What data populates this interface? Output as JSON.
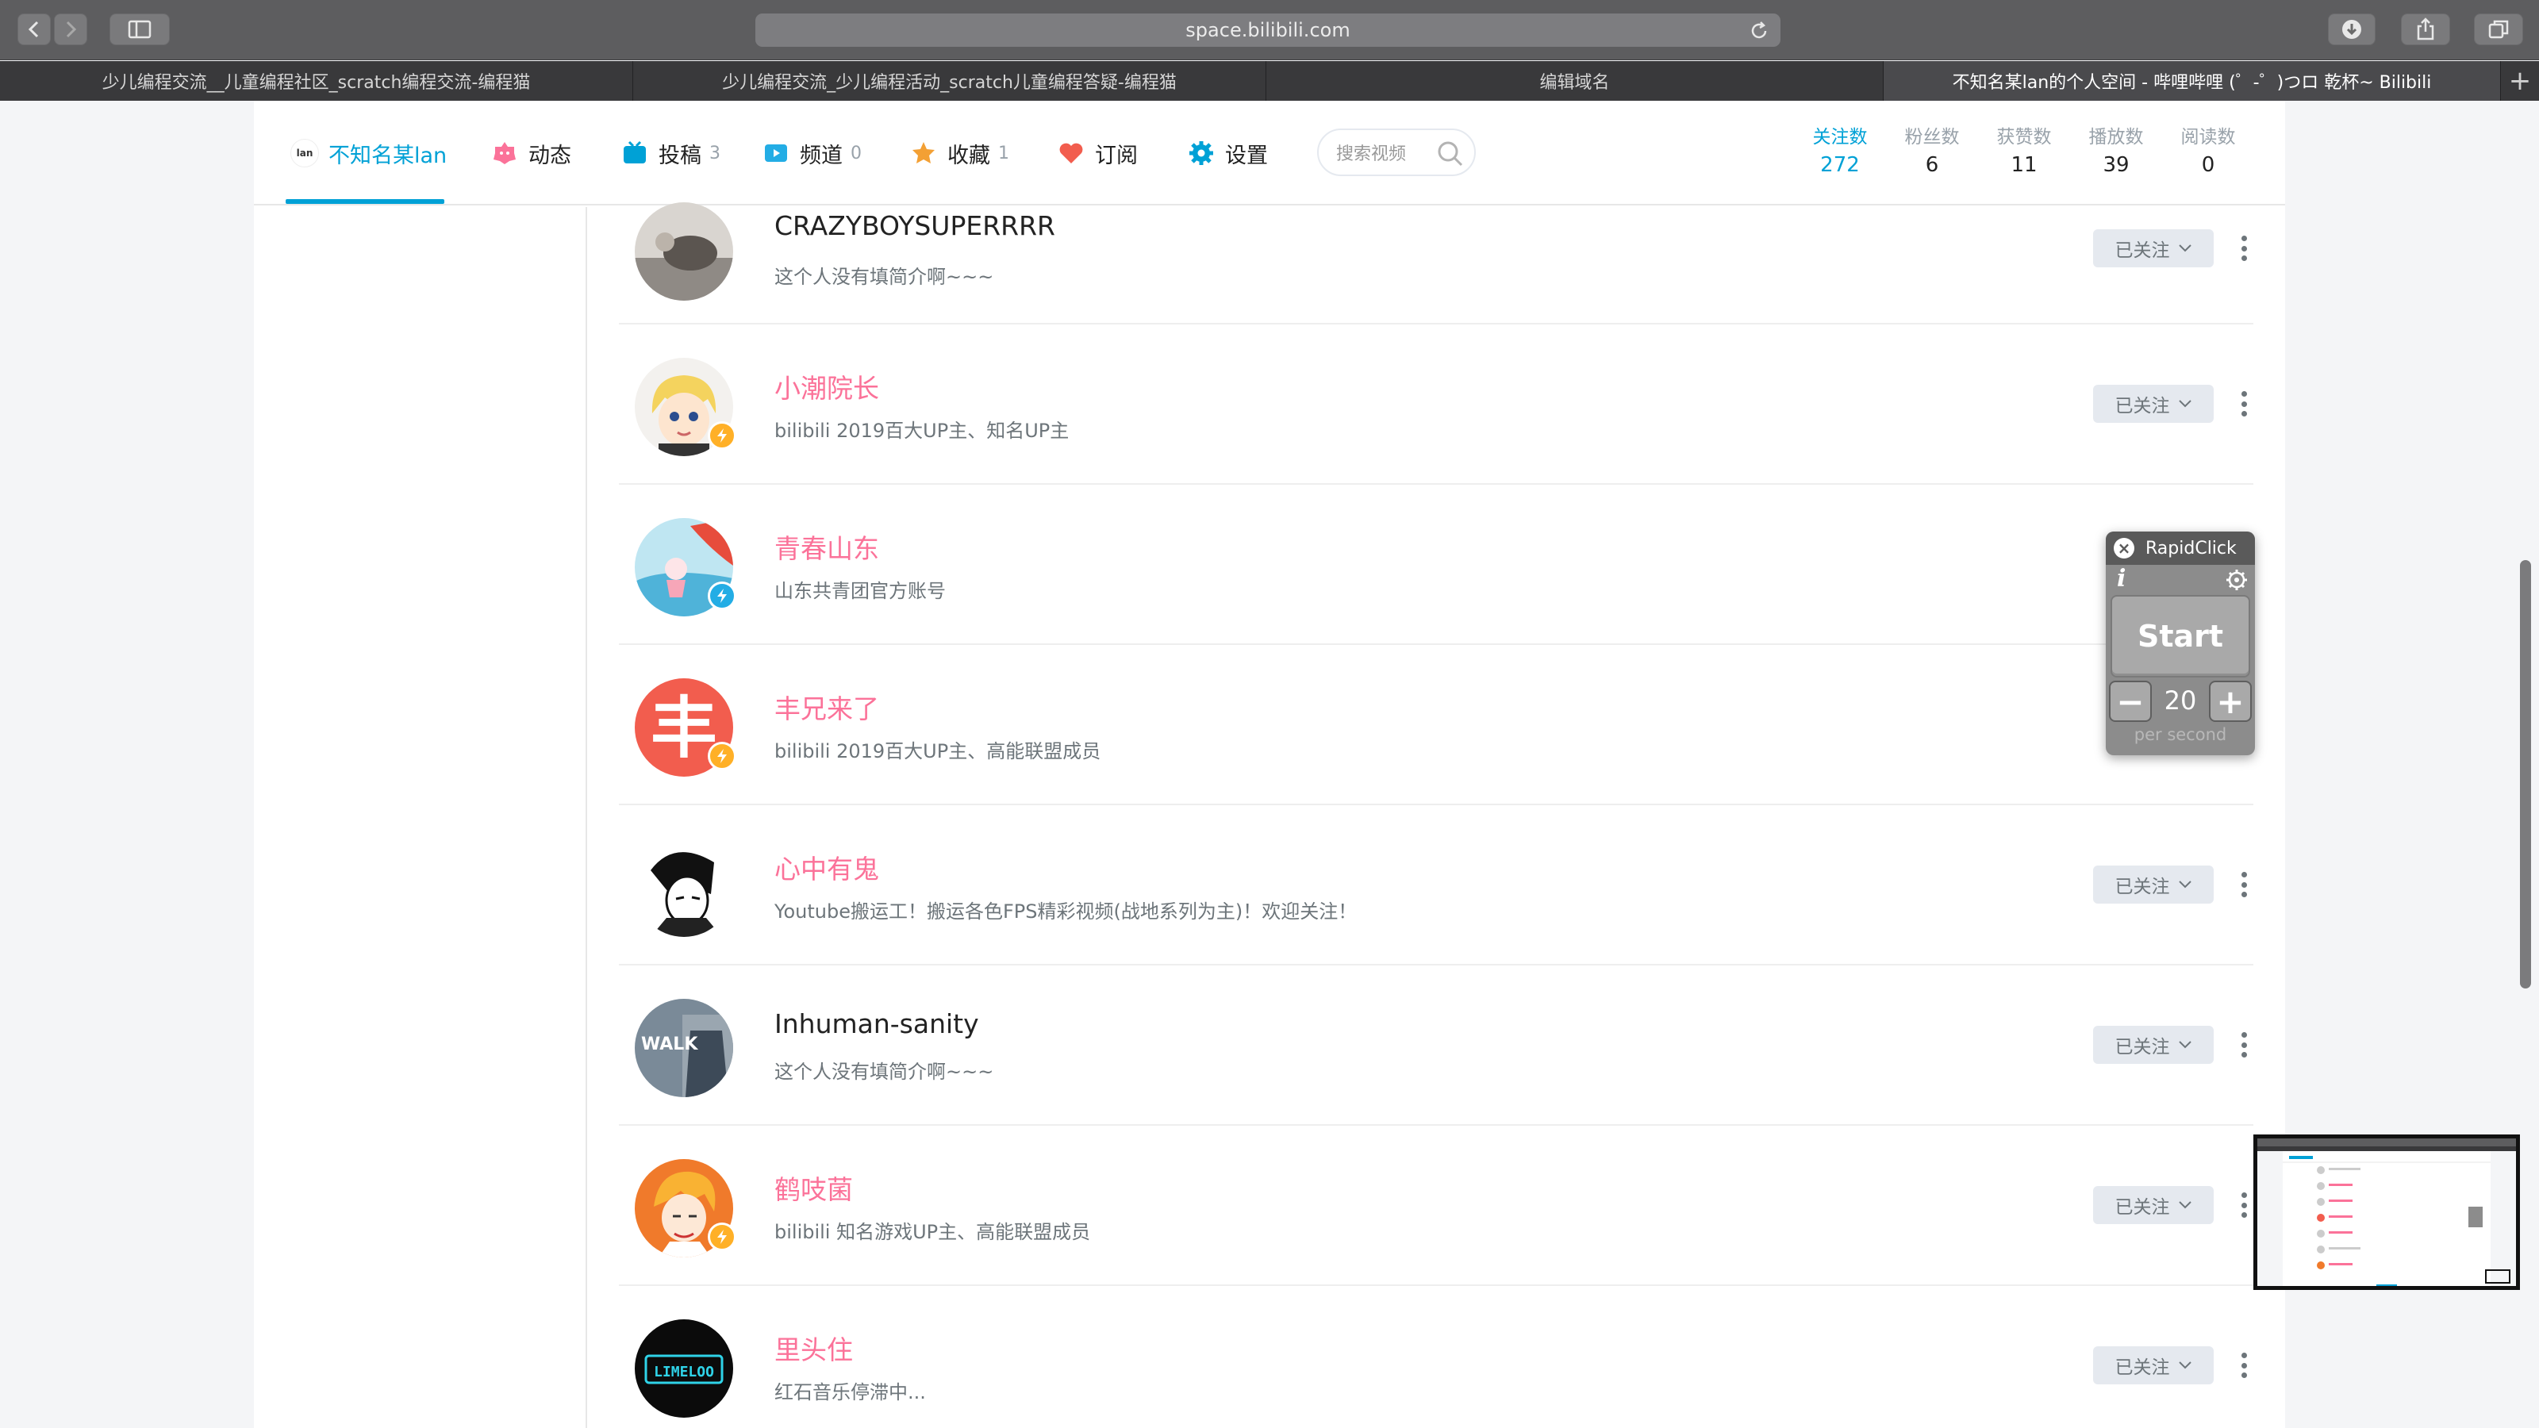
{
  "browser": {
    "url": "space.bilibili.com",
    "tabs": [
      {
        "title": "少儿编程交流__儿童编程社区_scratch编程交流-编程猫",
        "active": false
      },
      {
        "title": "少儿编程交流_少儿编程活动_scratch儿童编程答疑-编程猫",
        "active": false
      },
      {
        "title": "编辑域名",
        "active": false
      },
      {
        "title": "不知名某lan的个人空间 - 哔哩哔哩 (゜-゜)つロ 乾杯~ Bilibili",
        "active": true
      }
    ],
    "new_tab_glyph": "+"
  },
  "nav": {
    "logo_text": "lan",
    "home": "不知名某lan",
    "dynamic": "动态",
    "videos": "投稿",
    "videos_count": "3",
    "channels": "频道",
    "channels_count": "0",
    "favorites": "收藏",
    "favorites_count": "1",
    "subscriptions": "订阅",
    "settings": "设置",
    "search_placeholder": "搜索视频"
  },
  "stats": [
    {
      "label": "关注数",
      "value": "272",
      "active": true
    },
    {
      "label": "粉丝数",
      "value": "6",
      "active": false
    },
    {
      "label": "获赞数",
      "value": "11",
      "active": false
    },
    {
      "label": "播放数",
      "value": "39",
      "active": false
    },
    {
      "label": "阅读数",
      "value": "0",
      "active": false
    }
  ],
  "follow_button_label": "已关注",
  "following": [
    {
      "name": "CRAZYBOYSUPERRRR",
      "sign": "这个人没有填简介啊~~~",
      "vip": false,
      "badge": ""
    },
    {
      "name": "小潮院长",
      "sign": "bilibili 2019百大UP主、知名UP主",
      "vip": true,
      "badge": "yellow"
    },
    {
      "name": "青春山东",
      "sign": "山东共青团官方账号",
      "vip": true,
      "badge": "blue"
    },
    {
      "name": "丰兄来了",
      "sign": "bilibili 2019百大UP主、高能联盟成员",
      "vip": true,
      "badge": "yellow"
    },
    {
      "name": "心中有鬼",
      "sign": "Youtube搬运工！搬运各色FPS精彩视频(战地系列为主)！欢迎关注！",
      "vip": true,
      "badge": ""
    },
    {
      "name": "Inhuman-sanity",
      "sign": "这个人没有填简介啊~~~",
      "vip": false,
      "badge": ""
    },
    {
      "name": "鹤吱菌",
      "sign": "bilibili 知名游戏UP主、高能联盟成员",
      "vip": true,
      "badge": "yellow"
    },
    {
      "name": "里头住",
      "sign": "红石音乐停滞中...",
      "vip": true,
      "badge": ""
    }
  ],
  "avatar_texts": {
    "feng": "丰",
    "walk": "WALK",
    "limeloo": "LIMELOO"
  },
  "rapidclick": {
    "title": "RapidClick",
    "info": "i",
    "start_label": "Start",
    "rate": "20",
    "unit": "per second",
    "minus": "−",
    "plus": "+"
  },
  "colors": {
    "accent": "#00a1d6",
    "vip_name": "#fb7299",
    "badge_yellow": "#ffb027",
    "badge_blue": "#23ade5"
  }
}
